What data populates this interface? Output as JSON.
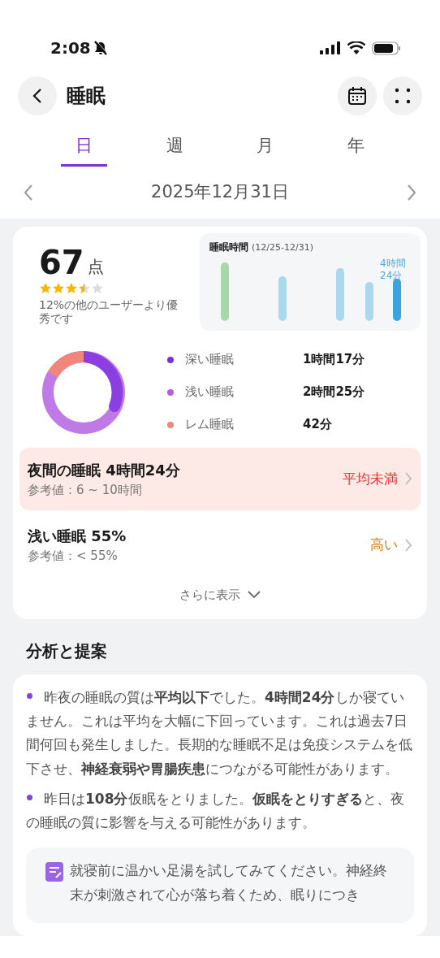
{
  "status_bar": {
    "time": "2:08",
    "muted": true
  },
  "header": {
    "title": "睡眠"
  },
  "tabs": [
    {
      "label": "日",
      "selected": true
    },
    {
      "label": "週",
      "selected": false
    },
    {
      "label": "月",
      "selected": false
    },
    {
      "label": "年",
      "selected": false
    }
  ],
  "date": "2025年12月31日",
  "score": {
    "value": "67",
    "unit": "点",
    "stars": 3.5,
    "comparison": "12%の他のユーザーより優秀です"
  },
  "duration_chart": {
    "title": "睡眠時間",
    "range": "(12/25-12/31)",
    "latest": "4時間24分"
  },
  "stages": [
    {
      "name": "深い睡眠",
      "value": "1時間17分",
      "color": "#7b2fd6"
    },
    {
      "name": "浅い睡眠",
      "value": "2時間25分",
      "color": "#b45ee0"
    },
    {
      "name": "レム睡眠",
      "value": "42分",
      "color": "#f0877a"
    }
  ],
  "metrics": [
    {
      "title": "夜間の睡眠 4時間24分",
      "reference": "参考値：6 ~ 10時間",
      "status": "平均未満",
      "kind": "below"
    },
    {
      "title": "浅い睡眠 55%",
      "reference": "参考値：< 55%",
      "status": "高い",
      "kind": "above"
    }
  ],
  "more": "さらに表示",
  "analysis": {
    "title": "分析と提案",
    "points": [
      "昨夜の睡眠の質は**平均以下**でした。**4時間24分**しか寝ていません。これは平均を大幅に下回っています。これは過去7日間何回も発生しました。長期的な睡眠不足は免疫システムを低下させ、**神経衰弱や胃腸疾患**につながる可能性があります。",
      "昨日は**108分**仮眠をとりました。**仮眠をとりすぎる**と、夜の睡眠の質に影響を与える可能性があります。"
    ],
    "tip": "就寝前に温かい足湯を試してみてください。神経終末が刺激されて心が落ち着くため、眠りにつき"
  }
}
